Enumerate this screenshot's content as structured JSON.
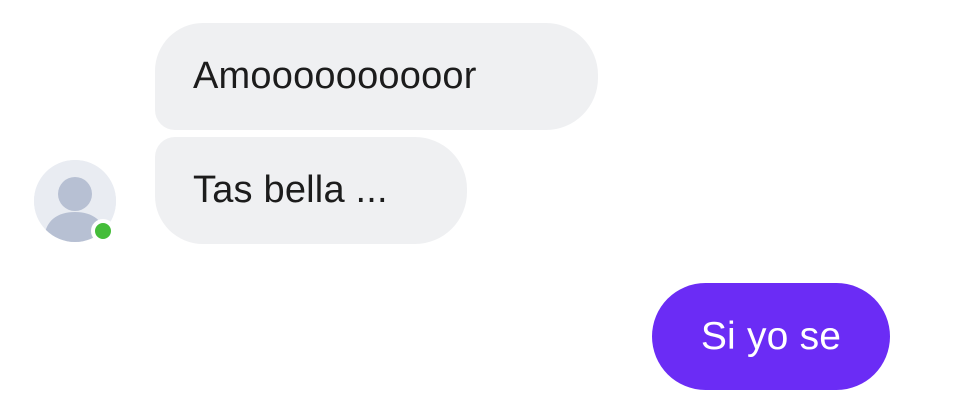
{
  "conversation": {
    "messages": [
      {
        "sender": "contact",
        "text": "Amoooooooooor"
      },
      {
        "sender": "contact",
        "text": "Tas bella ..."
      },
      {
        "sender": "me",
        "text": "Si yo se"
      }
    ],
    "contact": {
      "avatar_icon": "default-profile-icon",
      "presence": "online",
      "presence_color": "#45bd3a"
    }
  },
  "colors": {
    "incoming_bubble": "#eff0f2",
    "incoming_text": "#1c1c1c",
    "outgoing_bubble": "#6b2cf5",
    "outgoing_text": "#ffffff"
  }
}
